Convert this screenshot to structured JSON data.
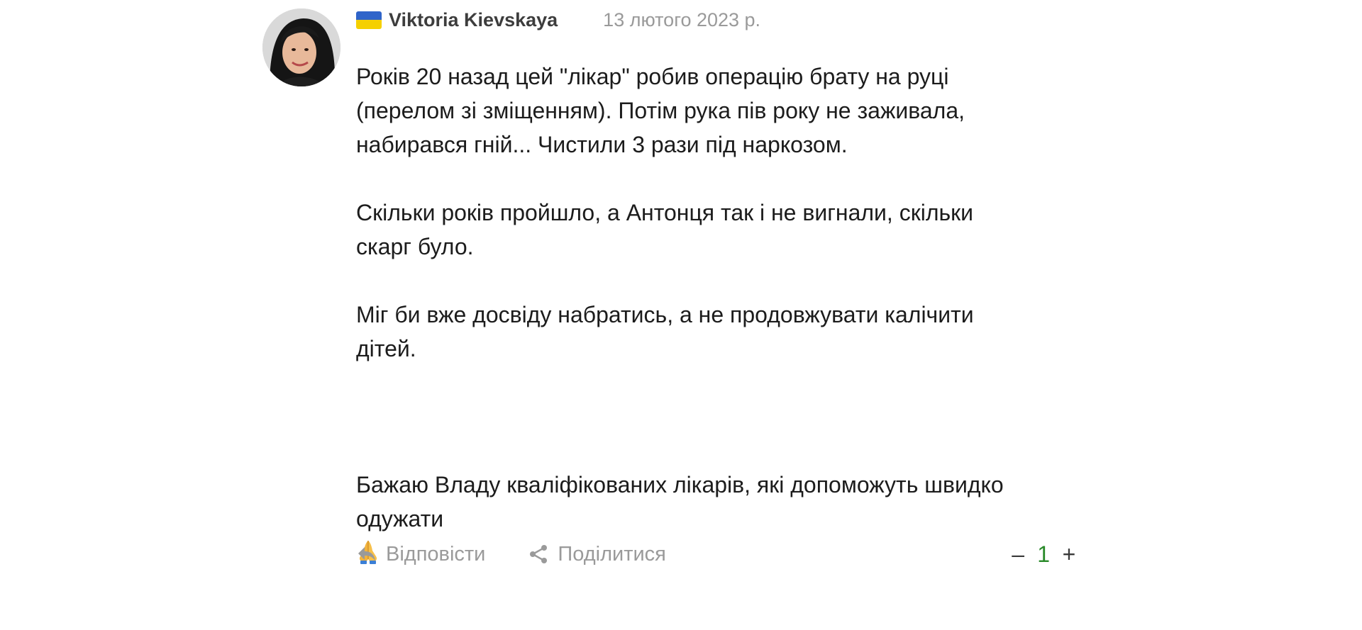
{
  "comment": {
    "author": "Viktoria Kievskaya",
    "date": "13 лютого 2023 р.",
    "flag_icon": "ukraine-flag-icon",
    "colors": {
      "flag_blue": "#2f64c9",
      "flag_yellow": "#f5d000",
      "score": "#2a8a2a",
      "muted": "#9a9a9a"
    },
    "paragraphs": [
      "Років 20 назад цей \"лікар\" робив операцію брату на руці\n(перелом зі зміщенням). Потім рука пів року не заживала,\nнабирався гній... Чистили 3 рази під наркозом.",
      "Скільки років пройшло, а Антонця так і не вигнали, скільки\nскарг було.",
      "Міг би вже досвіду набратись, а не продовжувати калічити\nдітей.",
      "Бажаю Владу кваліфікованих лікарів, які допоможуть швидко\nодужати"
    ],
    "emoji": "folded-hands-icon",
    "actions": {
      "reply_label": "Відповісти",
      "share_label": "Поділитися"
    },
    "votes": {
      "minus": "–",
      "score": "1",
      "plus": "+"
    }
  }
}
